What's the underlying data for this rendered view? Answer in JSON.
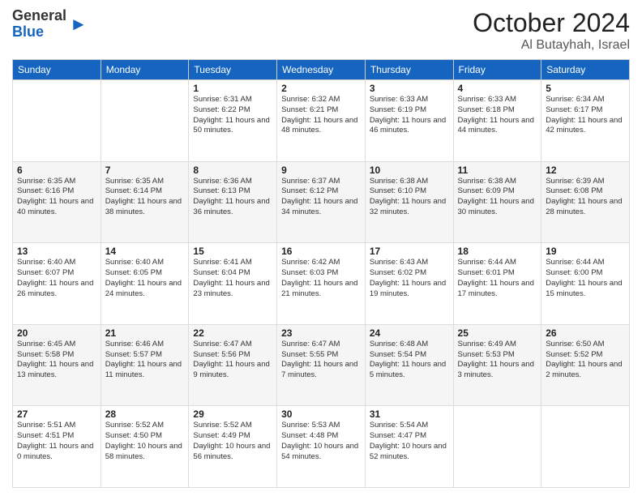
{
  "header": {
    "logo_general": "General",
    "logo_blue": "Blue",
    "month": "October 2024",
    "location": "Al Butayhah, Israel"
  },
  "weekdays": [
    "Sunday",
    "Monday",
    "Tuesday",
    "Wednesday",
    "Thursday",
    "Friday",
    "Saturday"
  ],
  "weeks": [
    [
      {
        "day": "",
        "info": ""
      },
      {
        "day": "",
        "info": ""
      },
      {
        "day": "1",
        "info": "Sunrise: 6:31 AM\nSunset: 6:22 PM\nDaylight: 11 hours and 50 minutes."
      },
      {
        "day": "2",
        "info": "Sunrise: 6:32 AM\nSunset: 6:21 PM\nDaylight: 11 hours and 48 minutes."
      },
      {
        "day": "3",
        "info": "Sunrise: 6:33 AM\nSunset: 6:19 PM\nDaylight: 11 hours and 46 minutes."
      },
      {
        "day": "4",
        "info": "Sunrise: 6:33 AM\nSunset: 6:18 PM\nDaylight: 11 hours and 44 minutes."
      },
      {
        "day": "5",
        "info": "Sunrise: 6:34 AM\nSunset: 6:17 PM\nDaylight: 11 hours and 42 minutes."
      }
    ],
    [
      {
        "day": "6",
        "info": "Sunrise: 6:35 AM\nSunset: 6:16 PM\nDaylight: 11 hours and 40 minutes."
      },
      {
        "day": "7",
        "info": "Sunrise: 6:35 AM\nSunset: 6:14 PM\nDaylight: 11 hours and 38 minutes."
      },
      {
        "day": "8",
        "info": "Sunrise: 6:36 AM\nSunset: 6:13 PM\nDaylight: 11 hours and 36 minutes."
      },
      {
        "day": "9",
        "info": "Sunrise: 6:37 AM\nSunset: 6:12 PM\nDaylight: 11 hours and 34 minutes."
      },
      {
        "day": "10",
        "info": "Sunrise: 6:38 AM\nSunset: 6:10 PM\nDaylight: 11 hours and 32 minutes."
      },
      {
        "day": "11",
        "info": "Sunrise: 6:38 AM\nSunset: 6:09 PM\nDaylight: 11 hours and 30 minutes."
      },
      {
        "day": "12",
        "info": "Sunrise: 6:39 AM\nSunset: 6:08 PM\nDaylight: 11 hours and 28 minutes."
      }
    ],
    [
      {
        "day": "13",
        "info": "Sunrise: 6:40 AM\nSunset: 6:07 PM\nDaylight: 11 hours and 26 minutes."
      },
      {
        "day": "14",
        "info": "Sunrise: 6:40 AM\nSunset: 6:05 PM\nDaylight: 11 hours and 24 minutes."
      },
      {
        "day": "15",
        "info": "Sunrise: 6:41 AM\nSunset: 6:04 PM\nDaylight: 11 hours and 23 minutes."
      },
      {
        "day": "16",
        "info": "Sunrise: 6:42 AM\nSunset: 6:03 PM\nDaylight: 11 hours and 21 minutes."
      },
      {
        "day": "17",
        "info": "Sunrise: 6:43 AM\nSunset: 6:02 PM\nDaylight: 11 hours and 19 minutes."
      },
      {
        "day": "18",
        "info": "Sunrise: 6:44 AM\nSunset: 6:01 PM\nDaylight: 11 hours and 17 minutes."
      },
      {
        "day": "19",
        "info": "Sunrise: 6:44 AM\nSunset: 6:00 PM\nDaylight: 11 hours and 15 minutes."
      }
    ],
    [
      {
        "day": "20",
        "info": "Sunrise: 6:45 AM\nSunset: 5:58 PM\nDaylight: 11 hours and 13 minutes."
      },
      {
        "day": "21",
        "info": "Sunrise: 6:46 AM\nSunset: 5:57 PM\nDaylight: 11 hours and 11 minutes."
      },
      {
        "day": "22",
        "info": "Sunrise: 6:47 AM\nSunset: 5:56 PM\nDaylight: 11 hours and 9 minutes."
      },
      {
        "day": "23",
        "info": "Sunrise: 6:47 AM\nSunset: 5:55 PM\nDaylight: 11 hours and 7 minutes."
      },
      {
        "day": "24",
        "info": "Sunrise: 6:48 AM\nSunset: 5:54 PM\nDaylight: 11 hours and 5 minutes."
      },
      {
        "day": "25",
        "info": "Sunrise: 6:49 AM\nSunset: 5:53 PM\nDaylight: 11 hours and 3 minutes."
      },
      {
        "day": "26",
        "info": "Sunrise: 6:50 AM\nSunset: 5:52 PM\nDaylight: 11 hours and 2 minutes."
      }
    ],
    [
      {
        "day": "27",
        "info": "Sunrise: 5:51 AM\nSunset: 4:51 PM\nDaylight: 11 hours and 0 minutes."
      },
      {
        "day": "28",
        "info": "Sunrise: 5:52 AM\nSunset: 4:50 PM\nDaylight: 10 hours and 58 minutes."
      },
      {
        "day": "29",
        "info": "Sunrise: 5:52 AM\nSunset: 4:49 PM\nDaylight: 10 hours and 56 minutes."
      },
      {
        "day": "30",
        "info": "Sunrise: 5:53 AM\nSunset: 4:48 PM\nDaylight: 10 hours and 54 minutes."
      },
      {
        "day": "31",
        "info": "Sunrise: 5:54 AM\nSunset: 4:47 PM\nDaylight: 10 hours and 52 minutes."
      },
      {
        "day": "",
        "info": ""
      },
      {
        "day": "",
        "info": ""
      }
    ]
  ]
}
